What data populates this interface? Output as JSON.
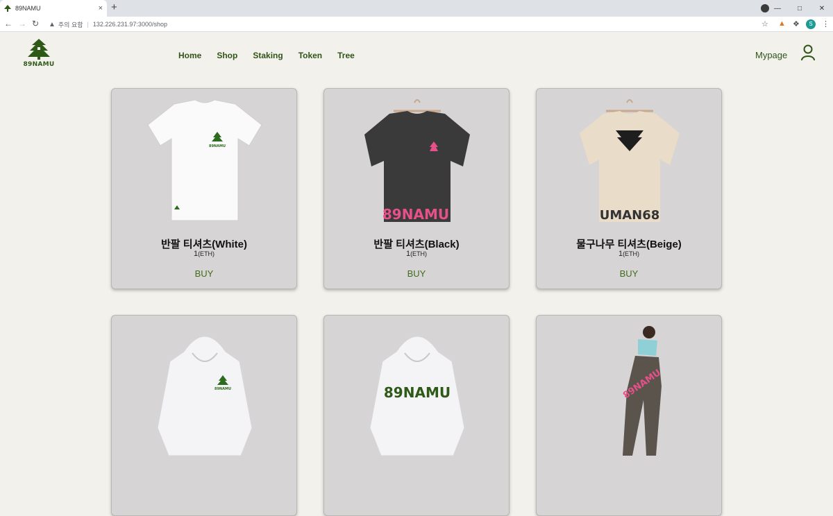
{
  "browser": {
    "tab_title": "89NAMU",
    "tab_close": "×",
    "new_tab": "+",
    "security_label": "주의 요함",
    "url": "132.226.231.97:3000/shop",
    "profile_initial": "S"
  },
  "site": {
    "logo_text": "89NAMU",
    "nav": [
      "Home",
      "Shop",
      "Staking",
      "Token",
      "Tree"
    ],
    "mypage": "Mypage"
  },
  "products": [
    {
      "name": "반팔 티셔츠(White)",
      "price": "1",
      "unit": "(ETH)",
      "buy": "BUY",
      "color": "#ffffff",
      "print": "logo-small"
    },
    {
      "name": "반팔 티셔츠(Black)",
      "price": "1",
      "unit": "(ETH)",
      "buy": "BUY",
      "color": "#3a3a3a",
      "print": "89NAMU"
    },
    {
      "name": "물구나무 티셔츠(Beige)",
      "price": "1",
      "unit": "(ETH)",
      "buy": "BUY",
      "color": "#e9dcc9",
      "print": "UMAN68"
    },
    {
      "color": "#f4f4f6",
      "print": "logo-small"
    },
    {
      "color": "#f4f4f6",
      "print": "89NAMU"
    },
    {
      "color": "#5b544d",
      "print": "89NAMU"
    }
  ],
  "colors": {
    "brand_green": "#2f5418",
    "accent_pink": "#e8508a",
    "card_bg": "#d6d4d4",
    "page_bg": "#f3f1ec"
  }
}
